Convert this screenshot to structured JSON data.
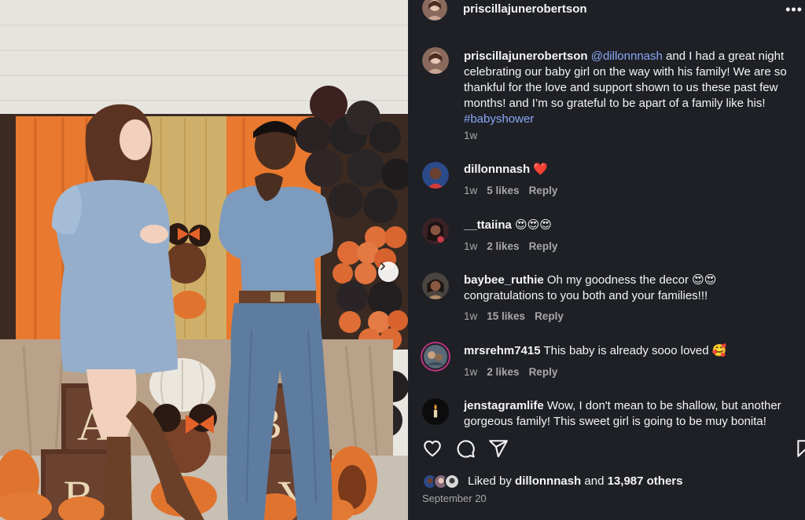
{
  "post": {
    "username": "priscillajunerobertson",
    "caption": {
      "username": "priscillajunerobertson",
      "mention": "@dillonnnash",
      "text_before_hashtag": " and I had a great night celebrating our baby girl on the way with his family! We are so thankful for the love and support shown to us these past few months! and I’m so grateful to be apart of a family like his! ",
      "hashtag": "#babyshower",
      "time": "1w"
    },
    "liked_by": {
      "prefix": "Liked by ",
      "user": "dillonnnash",
      "and": " and ",
      "others": "13,987 others"
    },
    "date": "September 20"
  },
  "comments": [
    {
      "username": "dillonnnash",
      "text": " ❤️",
      "time": "1w",
      "likes": "5 likes",
      "reply": "Reply"
    },
    {
      "username": "__ttaiina",
      "text": " 😍😍😍",
      "time": "1w",
      "likes": "2 likes",
      "reply": "Reply"
    },
    {
      "username": "baybee_ruthie",
      "text": " Oh my goodness the decor 😍😍 congratulations to you both and your families!!!",
      "time": "1w",
      "likes": "15 likes",
      "reply": "Reply"
    },
    {
      "username": "mrsrehm7415",
      "text": " This baby is already sooo loved 🥰",
      "time": "1w",
      "likes": "2 likes",
      "reply": "Reply"
    },
    {
      "username": "jenstagramlife",
      "text": " Wow, I don't mean to be shallow, but another gorgeous family! This sweet girl is going to be muy bonita!"
    }
  ],
  "icons": [
    "heart-icon",
    "comment-icon",
    "share-icon",
    "save-icon",
    "more-icon",
    "chevron-right-icon"
  ],
  "colors": {
    "background": "#1e2026",
    "link": "#8ca8f5",
    "meta": "#a8a8a8",
    "text": "#f5f5f5"
  },
  "photo": {
    "decor_letters": [
      "A",
      "B",
      "B",
      "Y"
    ]
  }
}
